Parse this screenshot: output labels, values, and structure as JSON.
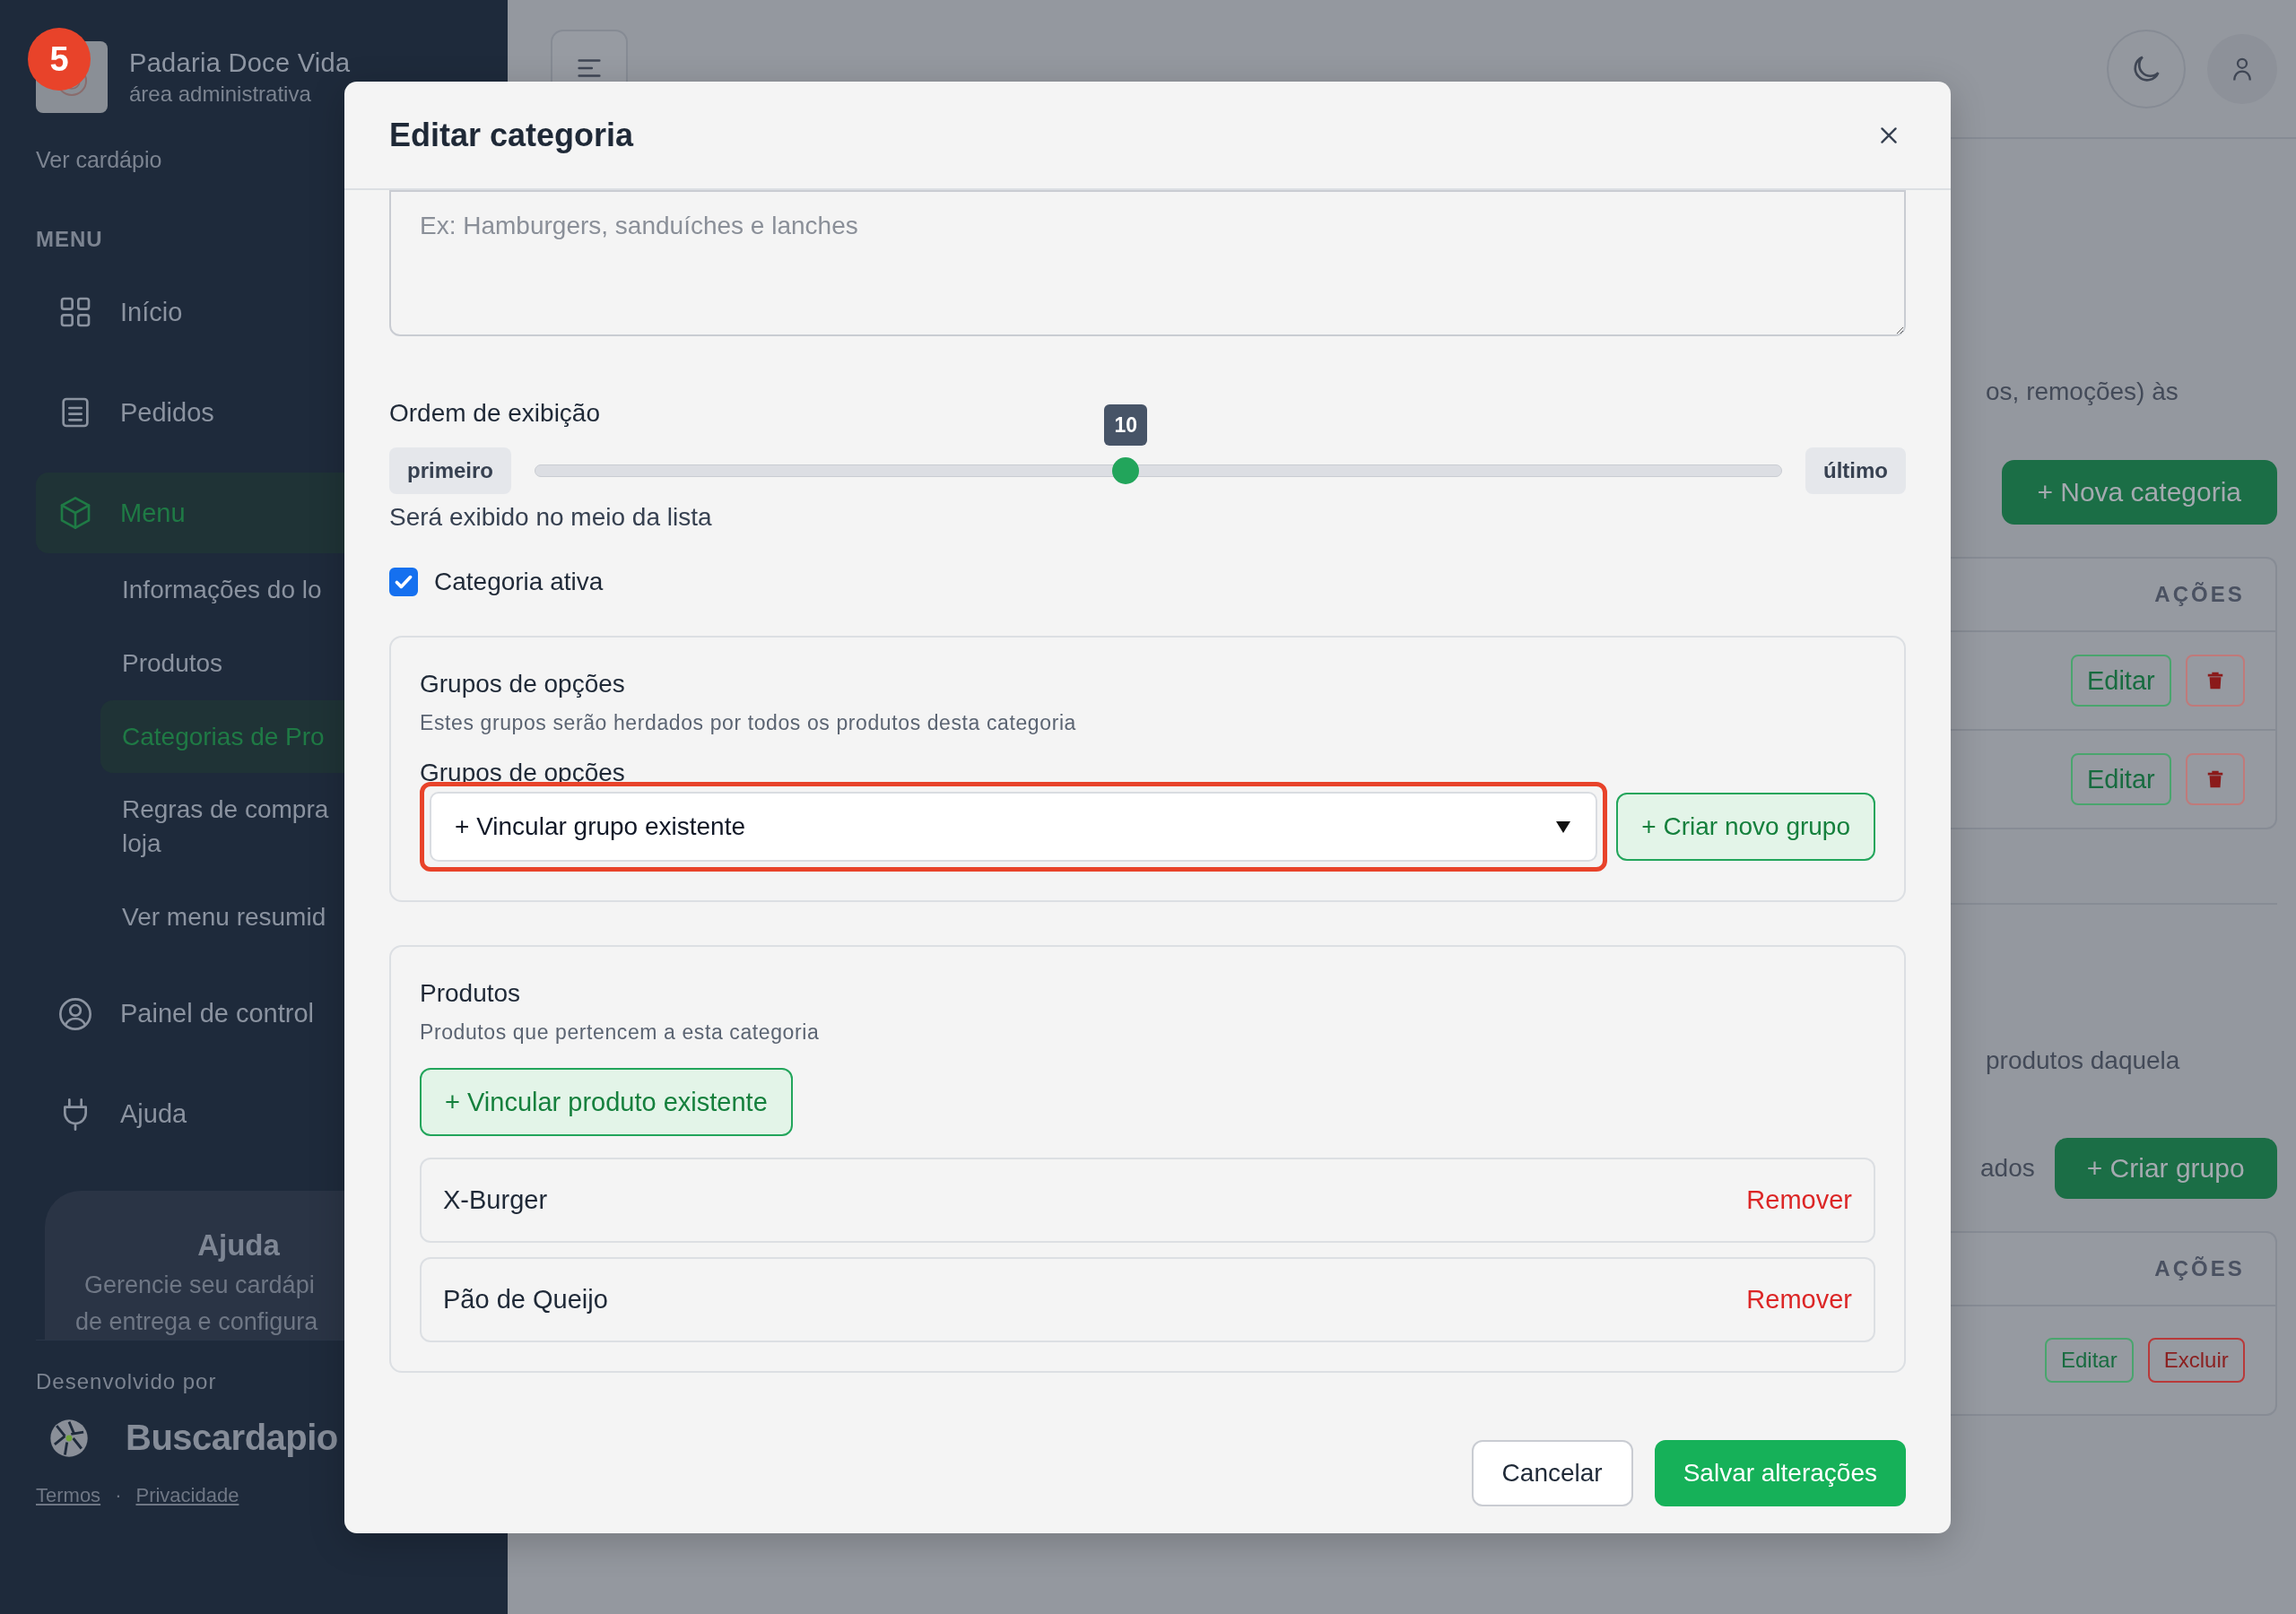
{
  "annotation": {
    "step": "5"
  },
  "sidebar": {
    "brand": {
      "name": "Padaria Doce Vida",
      "subtitle": "área administrativa"
    },
    "view_menu_link": "Ver cardápio",
    "section_label": "MENU",
    "items": [
      {
        "label": "Início",
        "selected": false
      },
      {
        "label": "Pedidos",
        "selected": false
      },
      {
        "label": "Menu",
        "selected": true,
        "children": [
          {
            "label": "Informações do lo",
            "selected": false
          },
          {
            "label": "Produtos",
            "selected": false
          },
          {
            "label": "Categorias de Pro",
            "selected": true
          },
          {
            "label": "Regras de compra\nloja",
            "selected": false
          },
          {
            "label": "Ver menu resumid",
            "selected": false
          }
        ]
      },
      {
        "label": "Painel de control",
        "selected": false
      },
      {
        "label": "Ajuda",
        "selected": false
      }
    ],
    "help_card": {
      "title": "Ajuda",
      "lines": [
        "Gerencie seu cardápi",
        "de entrega e configura"
      ]
    },
    "footer": {
      "developed_by": "Desenvolvido por",
      "brand": "Buscardapio",
      "links": [
        "Termos",
        "Privacidade"
      ],
      "separator": "·"
    }
  },
  "background_page": {
    "intro_fragment": "os, remoções) às",
    "new_category_button": "+ Nova categoria",
    "categories_table": {
      "columns": [
        "AÇÕES"
      ],
      "rows": [
        {
          "edit": "Editar"
        },
        {
          "edit": "Editar"
        }
      ]
    },
    "groups_fragment": "produtos daquela",
    "groups_heading_fragment": "ados",
    "create_group_button": "+ Criar grupo",
    "groups_table": {
      "columns": [
        "AÇÕES"
      ],
      "rows": [
        {
          "edit": "Editar",
          "delete": "Excluir"
        }
      ]
    }
  },
  "modal": {
    "title": "Editar categoria",
    "description_placeholder": "Ex: Hamburgers, sanduíches e lanches",
    "order": {
      "label": "Ordem de exibição",
      "min_label": "primeiro",
      "max_label": "último",
      "value": "10",
      "level": 0.474,
      "hint": "Será exibido no meio da lista"
    },
    "active": {
      "label": "Categoria ativa",
      "checked": true
    },
    "option_groups": {
      "title": "Grupos de opções",
      "description": "Estes grupos serão herdados por todos os produtos desta categoria",
      "field_label": "Grupos de opções",
      "select_value": "+ Vincular grupo existente",
      "highlighted": true,
      "create_button": "+ Criar novo grupo"
    },
    "products": {
      "title": "Produtos",
      "description": "Produtos que pertencem a esta categoria",
      "link_button": "+ Vincular produto existente",
      "items": [
        {
          "name": "X-Burger",
          "action": "Remover"
        },
        {
          "name": "Pão de Queijo",
          "action": "Remover"
        }
      ]
    },
    "buttons": {
      "cancel": "Cancelar",
      "save": "Salvar alterações"
    }
  }
}
